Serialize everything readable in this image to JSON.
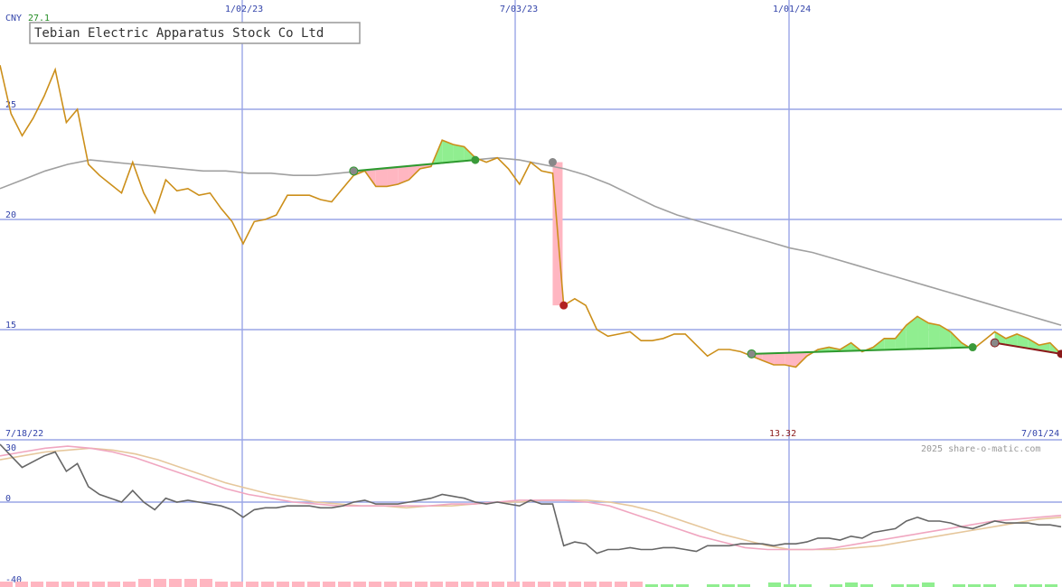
{
  "currency": "CNY",
  "max_value_label": "27.1",
  "title": "Tebian Electric Apparatus Stock Co Ltd",
  "start_date_label": "7/18/22",
  "end_date_label": "7/01/24",
  "last_value_label": "13.32",
  "copyright": "2025 share-o-matic.com",
  "colors": {
    "grid": "#9aa6e6",
    "axis_text": "#3344aa",
    "price": "#cc8f1a",
    "ma_long": "#a0a0a0",
    "gain_fill": "#90ee90",
    "loss_fill": "#ffb6c1",
    "trend_up": "#2e9a2e",
    "trend_down": "#8b1a1a",
    "osc_main": "#666666",
    "osc_fast": "#f0a6c0",
    "osc_slow": "#e6c79c",
    "vol_neg": "#ffb6c1",
    "vol_pos": "#90ee90",
    "max_value": "#228b22",
    "last_value": "#8b1a1a"
  },
  "chart_data": [
    {
      "type": "line",
      "name": "price",
      "x_ticks": [
        "1/02/23",
        "7/03/23",
        "1/01/24"
      ],
      "y_ticks": [
        15,
        20,
        25
      ],
      "ylim": [
        12.0,
        27.8
      ],
      "grid": true,
      "price_series": [
        27.0,
        24.8,
        23.8,
        24.6,
        25.6,
        26.8,
        24.4,
        25.0,
        22.5,
        22.0,
        21.6,
        21.2,
        22.6,
        21.2,
        20.3,
        21.8,
        21.3,
        21.4,
        21.1,
        21.2,
        20.5,
        19.9,
        18.9,
        19.9,
        20.0,
        20.2,
        21.1,
        21.1,
        21.1,
        20.9,
        20.8,
        21.4,
        22.0,
        22.2,
        21.5,
        21.5,
        21.6,
        21.8,
        22.3,
        22.4,
        23.6,
        23.4,
        23.3,
        22.8,
        22.6,
        22.8,
        22.3,
        21.6,
        22.6,
        22.2,
        22.1,
        16.1,
        16.4,
        16.1,
        15.0,
        14.7,
        14.8,
        14.9,
        14.5,
        14.5,
        14.6,
        14.8,
        14.8,
        14.3,
        13.8,
        14.1,
        14.1,
        14.0,
        13.8,
        13.6,
        13.4,
        13.4,
        13.3,
        13.8,
        14.1,
        14.2,
        14.1,
        14.4,
        14.0,
        14.2,
        14.6,
        14.6,
        15.2,
        15.6,
        15.3,
        15.2,
        14.9,
        14.4,
        14.1,
        14.5,
        14.9,
        14.6,
        14.8,
        14.6,
        14.3,
        14.4,
        13.9
      ],
      "ma_long_series": [
        21.4,
        21.8,
        22.2,
        22.5,
        22.7,
        22.6,
        22.5,
        22.4,
        22.3,
        22.2,
        22.2,
        22.1,
        22.1,
        22.0,
        22.0,
        22.1,
        22.2,
        22.3,
        22.4,
        22.5,
        22.6,
        22.7,
        22.8,
        22.7,
        22.5,
        22.3,
        22.0,
        21.6,
        21.1,
        20.6,
        20.2,
        19.9,
        19.6,
        19.3,
        19.0,
        18.7,
        18.5,
        18.2,
        17.9,
        17.6,
        17.3,
        17.0,
        16.7,
        16.4,
        16.1,
        15.8,
        15.5,
        15.2
      ],
      "trend_lines": [
        {
          "from": [
            32,
            22.2
          ],
          "to": [
            43,
            22.7
          ],
          "direction": "up"
        },
        {
          "from": [
            68,
            13.9
          ],
          "to": [
            88,
            14.2
          ],
          "direction": "up"
        },
        {
          "from": [
            90,
            14.4
          ],
          "to": [
            96,
            13.9
          ],
          "direction": "down"
        }
      ],
      "drop_marker": {
        "index_from": 50,
        "value_from": 22.6,
        "value_to": 16.1
      }
    },
    {
      "type": "line",
      "name": "oscillator",
      "y_ticks": [
        30,
        0,
        -40
      ],
      "ylim": [
        -40,
        30
      ],
      "main_series": [
        30,
        24,
        18,
        21,
        24,
        26,
        16,
        20,
        8,
        4,
        2,
        0,
        6,
        0,
        -4,
        2,
        0,
        1,
        0,
        -1,
        -2,
        -4,
        -8,
        -4,
        -3,
        -3,
        -2,
        -2,
        -2,
        -3,
        -3,
        -2,
        0,
        1,
        -1,
        -1,
        -1,
        0,
        1,
        2,
        4,
        3,
        2,
        0,
        -1,
        0,
        -1,
        -2,
        1,
        -1,
        -1,
        -23,
        -21,
        -22,
        -27,
        -25,
        -25,
        -24,
        -25,
        -25,
        -24,
        -24,
        -25,
        -26,
        -23,
        -23,
        -23,
        -22,
        -22,
        -22,
        -23,
        -22,
        -22,
        -21,
        -19,
        -19,
        -20,
        -18,
        -19,
        -16,
        -15,
        -14,
        -10,
        -8,
        -10,
        -10,
        -11,
        -13,
        -14,
        -12,
        -10,
        -11,
        -11,
        -11,
        -12,
        -12,
        -13
      ],
      "fast_series": [
        24,
        26,
        28,
        29,
        28,
        26,
        23,
        19,
        15,
        11,
        7,
        4,
        2,
        0,
        -1,
        -2,
        -2,
        -2,
        -2,
        -2,
        -1,
        -1,
        0,
        1,
        1,
        1,
        0,
        -2,
        -6,
        -10,
        -14,
        -18,
        -21,
        -24,
        -25,
        -25,
        -25,
        -24,
        -22,
        -20,
        -18,
        -16,
        -14,
        -12,
        -10,
        -9,
        -8,
        -7
      ],
      "slow_series": [
        22,
        24,
        26,
        27,
        28,
        27,
        25,
        22,
        18,
        14,
        10,
        7,
        4,
        2,
        0,
        -1,
        -2,
        -2,
        -3,
        -2,
        -2,
        -1,
        0,
        0,
        1,
        1,
        1,
        0,
        -2,
        -5,
        -9,
        -13,
        -17,
        -20,
        -23,
        -25,
        -25,
        -25,
        -24,
        -23,
        -21,
        -19,
        -17,
        -15,
        -13,
        -11,
        -9,
        -8
      ]
    }
  ]
}
